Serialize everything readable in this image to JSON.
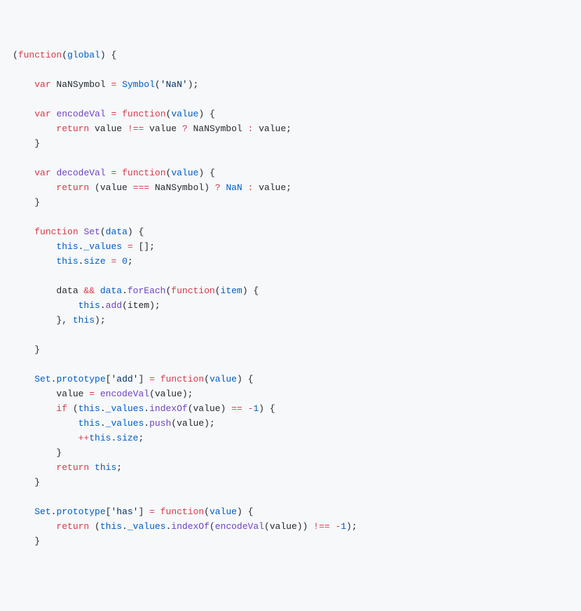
{
  "code": {
    "tokens": [
      {
        "c": "tok-p",
        "t": "("
      },
      {
        "c": "tok-kw",
        "t": "function"
      },
      {
        "c": "tok-p",
        "t": "("
      },
      {
        "c": "tok-id",
        "t": "global"
      },
      {
        "c": "tok-p",
        "t": ") {"
      },
      {
        "nl": true
      },
      {
        "nl": true
      },
      {
        "c": "tok-p",
        "t": "    "
      },
      {
        "c": "tok-kw",
        "t": "var"
      },
      {
        "c": "tok-p",
        "t": " NaNSymbol "
      },
      {
        "c": "tok-op",
        "t": "="
      },
      {
        "c": "tok-p",
        "t": " "
      },
      {
        "c": "tok-id",
        "t": "Symbol"
      },
      {
        "c": "tok-p",
        "t": "("
      },
      {
        "c": "tok-str",
        "t": "'NaN'"
      },
      {
        "c": "tok-p",
        "t": ");"
      },
      {
        "nl": true
      },
      {
        "nl": true
      },
      {
        "c": "tok-p",
        "t": "    "
      },
      {
        "c": "tok-kw",
        "t": "var"
      },
      {
        "c": "tok-p",
        "t": " "
      },
      {
        "c": "tok-def",
        "t": "encodeVal"
      },
      {
        "c": "tok-p",
        "t": " "
      },
      {
        "c": "tok-op",
        "t": "="
      },
      {
        "c": "tok-p",
        "t": " "
      },
      {
        "c": "tok-kw",
        "t": "function"
      },
      {
        "c": "tok-p",
        "t": "("
      },
      {
        "c": "tok-id",
        "t": "value"
      },
      {
        "c": "tok-p",
        "t": ") {"
      },
      {
        "nl": true
      },
      {
        "c": "tok-p",
        "t": "        "
      },
      {
        "c": "tok-kw",
        "t": "return"
      },
      {
        "c": "tok-p",
        "t": " value "
      },
      {
        "c": "tok-op",
        "t": "!=="
      },
      {
        "c": "tok-p",
        "t": " value "
      },
      {
        "c": "tok-op",
        "t": "?"
      },
      {
        "c": "tok-p",
        "t": " NaNSymbol "
      },
      {
        "c": "tok-op",
        "t": ":"
      },
      {
        "c": "tok-p",
        "t": " value;"
      },
      {
        "nl": true
      },
      {
        "c": "tok-p",
        "t": "    }"
      },
      {
        "nl": true
      },
      {
        "nl": true
      },
      {
        "c": "tok-p",
        "t": "    "
      },
      {
        "c": "tok-kw",
        "t": "var"
      },
      {
        "c": "tok-p",
        "t": " "
      },
      {
        "c": "tok-def",
        "t": "decodeVal"
      },
      {
        "c": "tok-p",
        "t": " "
      },
      {
        "c": "tok-op",
        "t": "="
      },
      {
        "c": "tok-p",
        "t": " "
      },
      {
        "c": "tok-kw",
        "t": "function"
      },
      {
        "c": "tok-p",
        "t": "("
      },
      {
        "c": "tok-id",
        "t": "value"
      },
      {
        "c": "tok-p",
        "t": ") {"
      },
      {
        "nl": true
      },
      {
        "c": "tok-p",
        "t": "        "
      },
      {
        "c": "tok-kw",
        "t": "return"
      },
      {
        "c": "tok-p",
        "t": " (value "
      },
      {
        "c": "tok-op",
        "t": "==="
      },
      {
        "c": "tok-p",
        "t": " NaNSymbol) "
      },
      {
        "c": "tok-op",
        "t": "?"
      },
      {
        "c": "tok-p",
        "t": " "
      },
      {
        "c": "tok-num",
        "t": "NaN"
      },
      {
        "c": "tok-p",
        "t": " "
      },
      {
        "c": "tok-op",
        "t": ":"
      },
      {
        "c": "tok-p",
        "t": " value;"
      },
      {
        "nl": true
      },
      {
        "c": "tok-p",
        "t": "    }"
      },
      {
        "nl": true
      },
      {
        "nl": true
      },
      {
        "c": "tok-p",
        "t": "    "
      },
      {
        "c": "tok-kw",
        "t": "function"
      },
      {
        "c": "tok-p",
        "t": " "
      },
      {
        "c": "tok-def",
        "t": "Set"
      },
      {
        "c": "tok-p",
        "t": "("
      },
      {
        "c": "tok-id",
        "t": "data"
      },
      {
        "c": "tok-p",
        "t": ") {"
      },
      {
        "nl": true
      },
      {
        "c": "tok-p",
        "t": "        "
      },
      {
        "c": "tok-id",
        "t": "this"
      },
      {
        "c": "tok-p",
        "t": "."
      },
      {
        "c": "tok-id",
        "t": "_values"
      },
      {
        "c": "tok-p",
        "t": " "
      },
      {
        "c": "tok-op",
        "t": "="
      },
      {
        "c": "tok-p",
        "t": " [];"
      },
      {
        "nl": true
      },
      {
        "c": "tok-p",
        "t": "        "
      },
      {
        "c": "tok-id",
        "t": "this"
      },
      {
        "c": "tok-p",
        "t": "."
      },
      {
        "c": "tok-id",
        "t": "size"
      },
      {
        "c": "tok-p",
        "t": " "
      },
      {
        "c": "tok-op",
        "t": "="
      },
      {
        "c": "tok-p",
        "t": " "
      },
      {
        "c": "tok-num",
        "t": "0"
      },
      {
        "c": "tok-p",
        "t": ";"
      },
      {
        "nl": true
      },
      {
        "nl": true
      },
      {
        "c": "tok-p",
        "t": "        data "
      },
      {
        "c": "tok-op",
        "t": "&&"
      },
      {
        "c": "tok-p",
        "t": " "
      },
      {
        "c": "tok-id",
        "t": "data"
      },
      {
        "c": "tok-p",
        "t": "."
      },
      {
        "c": "tok-def",
        "t": "forEach"
      },
      {
        "c": "tok-p",
        "t": "("
      },
      {
        "c": "tok-kw",
        "t": "function"
      },
      {
        "c": "tok-p",
        "t": "("
      },
      {
        "c": "tok-id",
        "t": "item"
      },
      {
        "c": "tok-p",
        "t": ") {"
      },
      {
        "nl": true
      },
      {
        "c": "tok-p",
        "t": "            "
      },
      {
        "c": "tok-id",
        "t": "this"
      },
      {
        "c": "tok-p",
        "t": "."
      },
      {
        "c": "tok-def",
        "t": "add"
      },
      {
        "c": "tok-p",
        "t": "(item);"
      },
      {
        "nl": true
      },
      {
        "c": "tok-p",
        "t": "        }, "
      },
      {
        "c": "tok-id",
        "t": "this"
      },
      {
        "c": "tok-p",
        "t": ");"
      },
      {
        "nl": true
      },
      {
        "nl": true
      },
      {
        "c": "tok-p",
        "t": "    }"
      },
      {
        "nl": true
      },
      {
        "nl": true
      },
      {
        "c": "tok-p",
        "t": "    "
      },
      {
        "c": "tok-id",
        "t": "Set"
      },
      {
        "c": "tok-p",
        "t": "."
      },
      {
        "c": "tok-id",
        "t": "prototype"
      },
      {
        "c": "tok-p",
        "t": "["
      },
      {
        "c": "tok-str",
        "t": "'add'"
      },
      {
        "c": "tok-p",
        "t": "] "
      },
      {
        "c": "tok-op",
        "t": "="
      },
      {
        "c": "tok-p",
        "t": " "
      },
      {
        "c": "tok-kw",
        "t": "function"
      },
      {
        "c": "tok-p",
        "t": "("
      },
      {
        "c": "tok-id",
        "t": "value"
      },
      {
        "c": "tok-p",
        "t": ") {"
      },
      {
        "nl": true
      },
      {
        "c": "tok-p",
        "t": "        value "
      },
      {
        "c": "tok-op",
        "t": "="
      },
      {
        "c": "tok-p",
        "t": " "
      },
      {
        "c": "tok-def",
        "t": "encodeVal"
      },
      {
        "c": "tok-p",
        "t": "(value);"
      },
      {
        "nl": true
      },
      {
        "c": "tok-p",
        "t": "        "
      },
      {
        "c": "tok-kw",
        "t": "if"
      },
      {
        "c": "tok-p",
        "t": " ("
      },
      {
        "c": "tok-id",
        "t": "this"
      },
      {
        "c": "tok-p",
        "t": "."
      },
      {
        "c": "tok-id",
        "t": "_values"
      },
      {
        "c": "tok-p",
        "t": "."
      },
      {
        "c": "tok-def",
        "t": "indexOf"
      },
      {
        "c": "tok-p",
        "t": "(value) "
      },
      {
        "c": "tok-op",
        "t": "=="
      },
      {
        "c": "tok-p",
        "t": " "
      },
      {
        "c": "tok-op",
        "t": "-"
      },
      {
        "c": "tok-num",
        "t": "1"
      },
      {
        "c": "tok-p",
        "t": ") {"
      },
      {
        "nl": true
      },
      {
        "c": "tok-p",
        "t": "            "
      },
      {
        "c": "tok-id",
        "t": "this"
      },
      {
        "c": "tok-p",
        "t": "."
      },
      {
        "c": "tok-id",
        "t": "_values"
      },
      {
        "c": "tok-p",
        "t": "."
      },
      {
        "c": "tok-def",
        "t": "push"
      },
      {
        "c": "tok-p",
        "t": "(value);"
      },
      {
        "nl": true
      },
      {
        "c": "tok-p",
        "t": "            "
      },
      {
        "c": "tok-op",
        "t": "++"
      },
      {
        "c": "tok-id",
        "t": "this"
      },
      {
        "c": "tok-p",
        "t": "."
      },
      {
        "c": "tok-id",
        "t": "size"
      },
      {
        "c": "tok-p",
        "t": ";"
      },
      {
        "nl": true
      },
      {
        "c": "tok-p",
        "t": "        }"
      },
      {
        "nl": true
      },
      {
        "c": "tok-p",
        "t": "        "
      },
      {
        "c": "tok-kw",
        "t": "return"
      },
      {
        "c": "tok-p",
        "t": " "
      },
      {
        "c": "tok-id",
        "t": "this"
      },
      {
        "c": "tok-p",
        "t": ";"
      },
      {
        "nl": true
      },
      {
        "c": "tok-p",
        "t": "    }"
      },
      {
        "nl": true
      },
      {
        "nl": true
      },
      {
        "c": "tok-p",
        "t": "    "
      },
      {
        "c": "tok-id",
        "t": "Set"
      },
      {
        "c": "tok-p",
        "t": "."
      },
      {
        "c": "tok-id",
        "t": "prototype"
      },
      {
        "c": "tok-p",
        "t": "["
      },
      {
        "c": "tok-str",
        "t": "'has'"
      },
      {
        "c": "tok-p",
        "t": "] "
      },
      {
        "c": "tok-op",
        "t": "="
      },
      {
        "c": "tok-p",
        "t": " "
      },
      {
        "c": "tok-kw",
        "t": "function"
      },
      {
        "c": "tok-p",
        "t": "("
      },
      {
        "c": "tok-id",
        "t": "value"
      },
      {
        "c": "tok-p",
        "t": ") {"
      },
      {
        "nl": true
      },
      {
        "c": "tok-p",
        "t": "        "
      },
      {
        "c": "tok-kw",
        "t": "return"
      },
      {
        "c": "tok-p",
        "t": " ("
      },
      {
        "c": "tok-id",
        "t": "this"
      },
      {
        "c": "tok-p",
        "t": "."
      },
      {
        "c": "tok-id",
        "t": "_values"
      },
      {
        "c": "tok-p",
        "t": "."
      },
      {
        "c": "tok-def",
        "t": "indexOf"
      },
      {
        "c": "tok-p",
        "t": "("
      },
      {
        "c": "tok-def",
        "t": "encodeVal"
      },
      {
        "c": "tok-p",
        "t": "(value)) "
      },
      {
        "c": "tok-op",
        "t": "!=="
      },
      {
        "c": "tok-p",
        "t": " "
      },
      {
        "c": "tok-op",
        "t": "-"
      },
      {
        "c": "tok-num",
        "t": "1"
      },
      {
        "c": "tok-p",
        "t": ");"
      },
      {
        "nl": true
      },
      {
        "c": "tok-p",
        "t": "    }"
      }
    ]
  }
}
